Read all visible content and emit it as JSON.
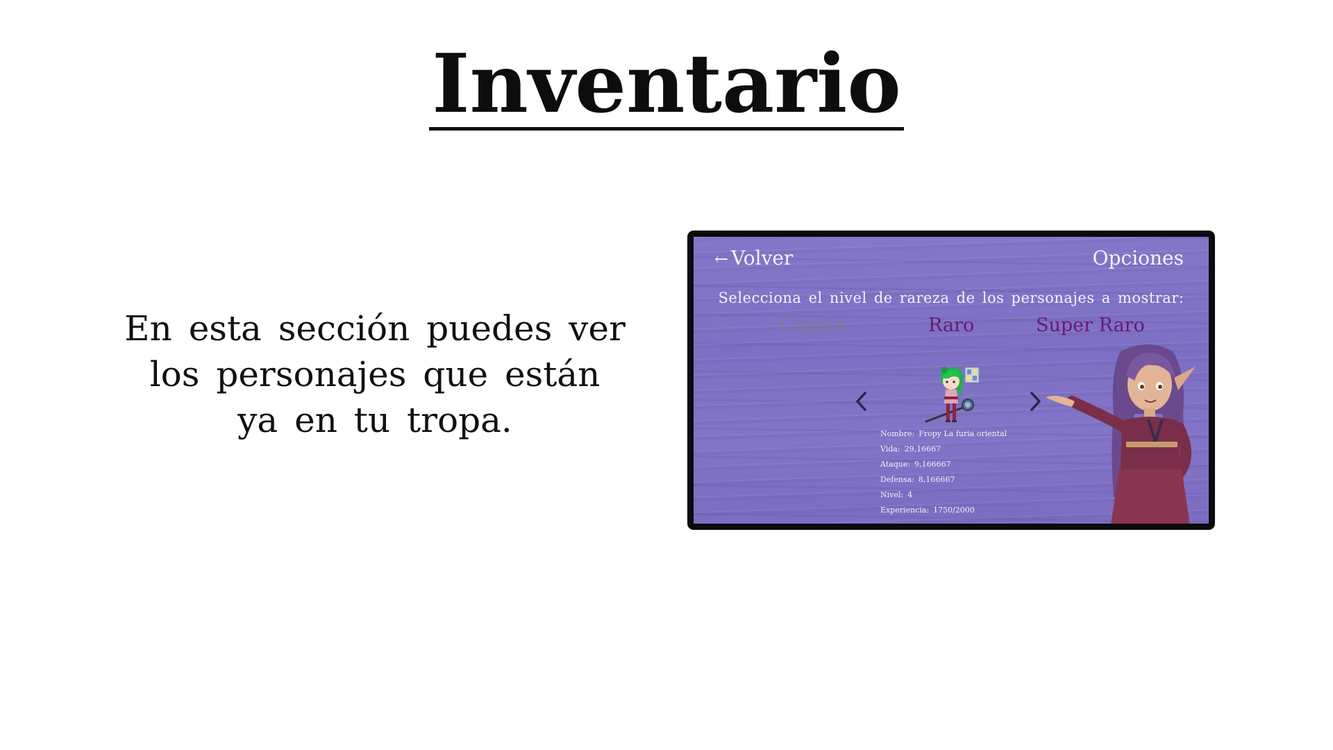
{
  "slide": {
    "title": "Inventario",
    "description_lines": [
      "En esta sección puedes ver",
      "los personajes que están",
      "ya en tu tropa."
    ]
  },
  "game": {
    "back_arrow": "←",
    "back_label": "Volver",
    "options_label": "Opciones",
    "rarity_prompt": "Selecciona el nivel de rareza de los personajes a mostrar:",
    "rarities": [
      "Común",
      "Raro",
      "Super Raro"
    ],
    "character": {
      "name_label": "Nombre:",
      "name": "Fropy La furia oriental",
      "hp_label": "Vida:",
      "hp": "29,16667",
      "attack_label": "Ataque:",
      "attack": "9,166667",
      "defense_label": "Defensa:",
      "defense": "8,166667",
      "level_label": "Nivel:",
      "level": "4",
      "xp_label": "Experiencia:",
      "xp": "1750/2000"
    },
    "colors": {
      "background": "#8174c5",
      "rarity_inactive": "#807a8f",
      "rarity_active": "#6b1a6f",
      "text": "#f4f2fb"
    }
  },
  "icons": {
    "prev": "chevron-left-icon",
    "next": "chevron-right-icon"
  }
}
